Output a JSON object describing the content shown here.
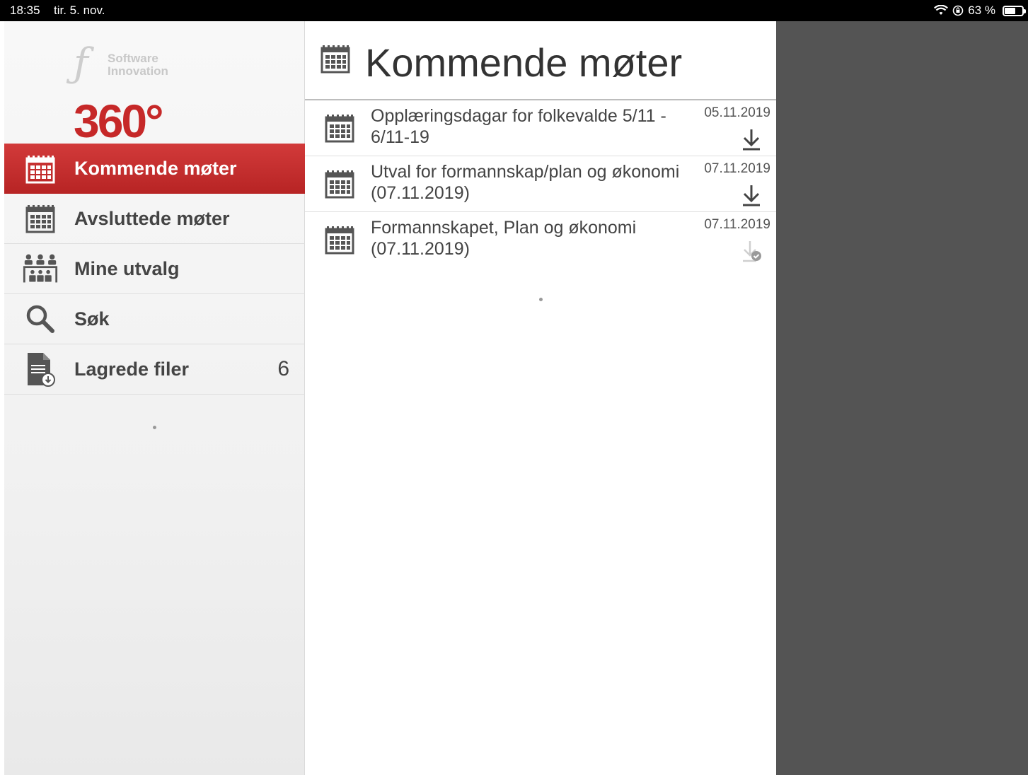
{
  "status_bar": {
    "time": "18:35",
    "date": "tir. 5. nov.",
    "battery_text": "63 %",
    "battery_level": 0.63
  },
  "logo": {
    "brand_line1": "Software",
    "brand_line2": "Innovation",
    "product": "360°"
  },
  "sidebar": {
    "items": [
      {
        "label": "Kommende møter",
        "icon": "calendar-icon",
        "active": true
      },
      {
        "label": "Avsluttede møter",
        "icon": "calendar-icon",
        "active": false
      },
      {
        "label": "Mine utvalg",
        "icon": "committee-icon",
        "active": false
      },
      {
        "label": "Søk",
        "icon": "search-icon",
        "active": false
      },
      {
        "label": "Lagrede filer",
        "icon": "saved-file-icon",
        "active": false,
        "count": "6"
      }
    ]
  },
  "main": {
    "title": "Kommende møter",
    "meetings": [
      {
        "title": "Opplæringsdagar for folkevalde 5/11 - 6/11-19",
        "date": "05.11.2019",
        "status": "download-icon"
      },
      {
        "title": "Utval for formannskap/plan og økonomi (07.11.2019)",
        "date": "07.11.2019",
        "status": "download-icon"
      },
      {
        "title": "Formannskapet, Plan og økonomi (07.11.2019)",
        "date": "07.11.2019",
        "status": "downloaded-check-icon"
      }
    ]
  },
  "colors": {
    "accent": "#c62828",
    "dark_panel": "#545454",
    "text": "#444444"
  }
}
